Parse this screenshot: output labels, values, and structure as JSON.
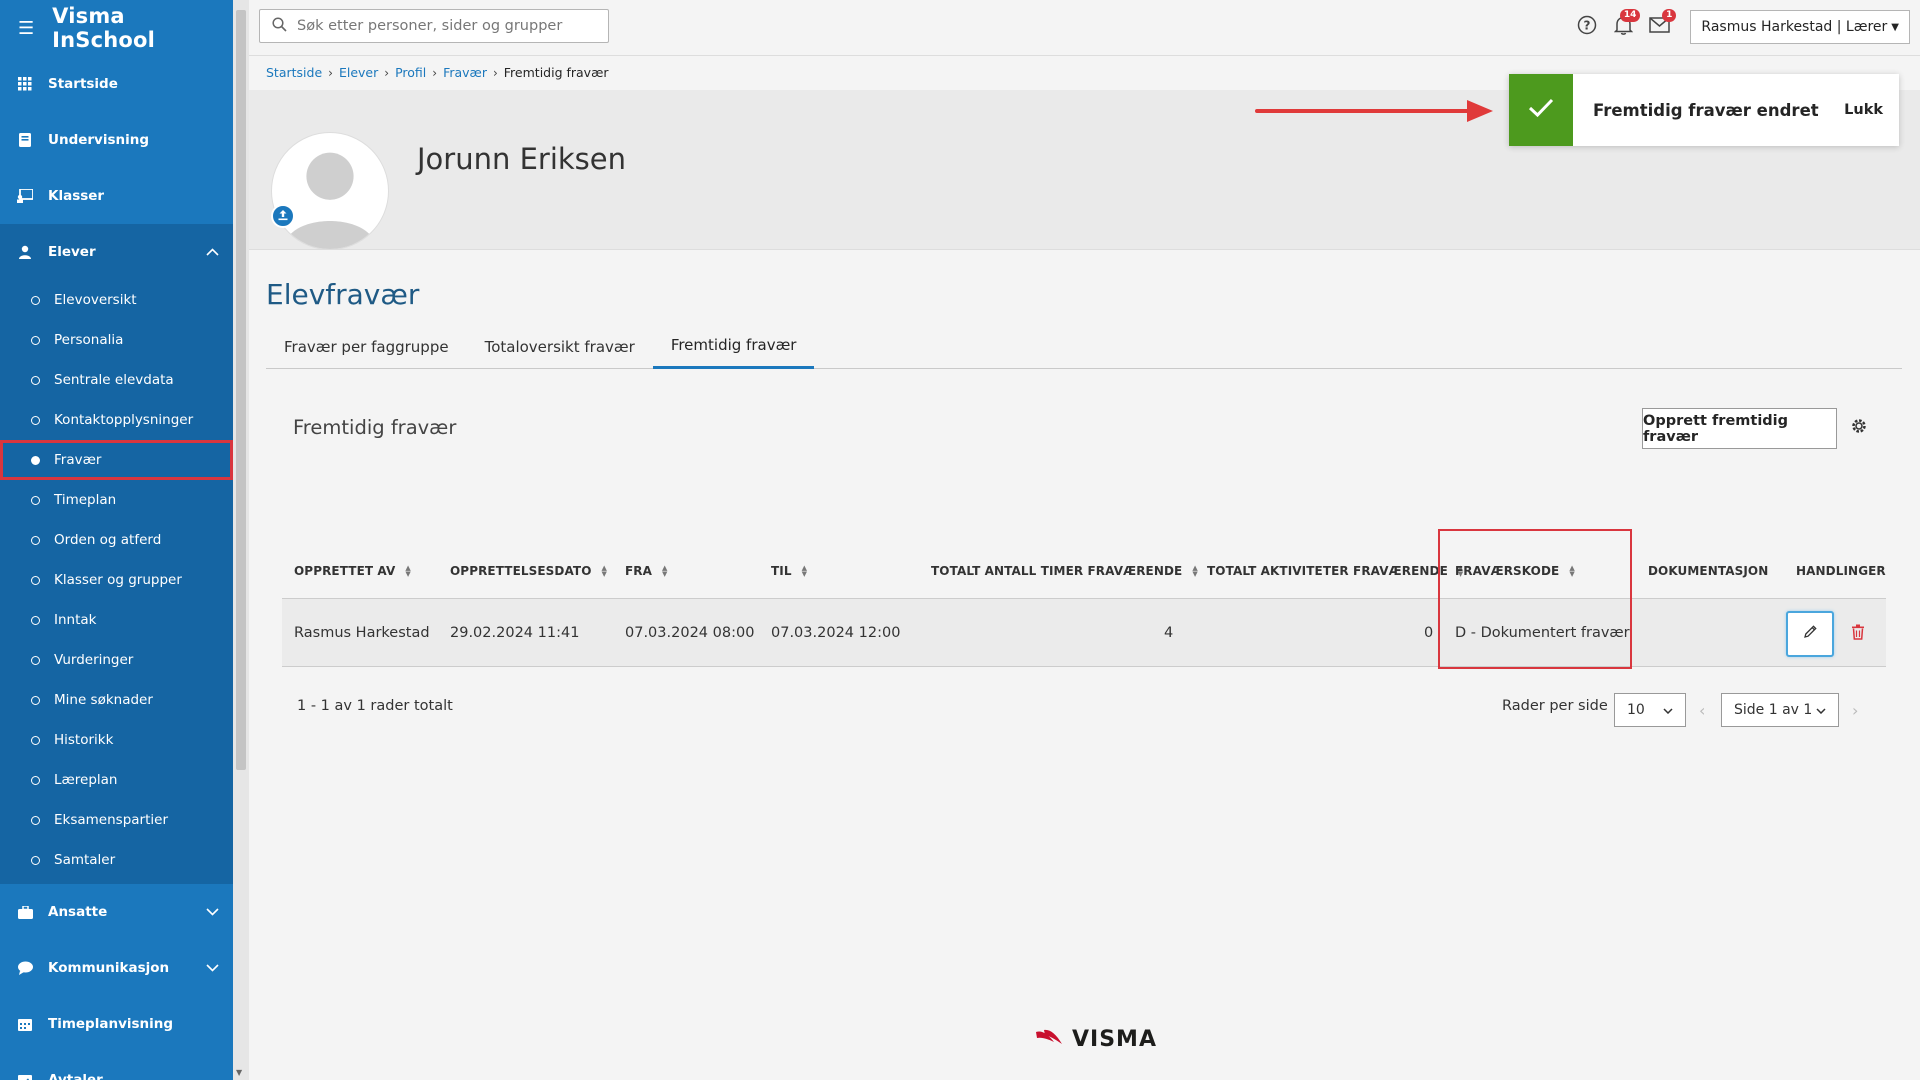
{
  "app": {
    "title": "Visma InSchool"
  },
  "sidebar": {
    "items": [
      {
        "label": "Startside",
        "icon": "grid-icon"
      },
      {
        "label": "Undervisning",
        "icon": "book-icon"
      },
      {
        "label": "Klasser",
        "icon": "board-icon"
      },
      {
        "label": "Elever",
        "icon": "student-icon"
      }
    ],
    "elever_sub": [
      "Elevoversikt",
      "Personalia",
      "Sentrale elevdata",
      "Kontaktopplysninger",
      "Fravær",
      "Timeplan",
      "Orden og atferd",
      "Klasser og grupper",
      "Inntak",
      "Vurderinger",
      "Mine søknader",
      "Historikk",
      "Læreplan",
      "Eksamenspartier",
      "Samtaler"
    ],
    "bottom_items": [
      {
        "label": "Ansatte",
        "icon": "briefcase-icon"
      },
      {
        "label": "Kommunikasjon",
        "icon": "chat-icon"
      },
      {
        "label": "Timeplanvisning",
        "icon": "calendar-icon"
      },
      {
        "label": "Avtaler",
        "icon": "calendar-check-icon"
      }
    ],
    "active_sub": "Fravær"
  },
  "topbar": {
    "search_placeholder": "Søk etter personer, sider og grupper",
    "notifications_count": "14",
    "messages_count": "1",
    "user_label": "Rasmus Harkestad | Lærer"
  },
  "breadcrumb": {
    "items": [
      "Startside",
      "Elever",
      "Profil",
      "Fravær"
    ],
    "current": "Fremtidig fravær"
  },
  "profile": {
    "name": "Jorunn Eriksen"
  },
  "toast": {
    "message": "Fremtidig fravær endret",
    "close_label": "Lukk"
  },
  "page": {
    "title": "Elevfravær",
    "tabs": [
      "Fravær per faggruppe",
      "Totaloversikt fravær",
      "Fremtidig fravær"
    ],
    "active_tab": "Fremtidig fravær"
  },
  "panel": {
    "title": "Fremtidig fravær",
    "create_button": "Opprett fremtidig fravær"
  },
  "table": {
    "columns": [
      "OPPRETTET AV",
      "OPPRETTELSESDATO",
      "FRA",
      "TIL",
      "TOTALT ANTALL TIMER FRAVÆRENDE",
      "TOTALT AKTIVITETER FRAVÆRENDE",
      "FRAVÆRSKODE",
      "DOKUMENTASJON",
      "HANDLINGER"
    ],
    "rows": [
      {
        "opprettet_av": "Rasmus Harkestad",
        "opprettelsesdato": "29.02.2024 11:41",
        "fra": "07.03.2024 08:00",
        "til": "07.03.2024 12:00",
        "timer": "4",
        "aktiviteter": "0",
        "kode": "D - Dokumentert fravær",
        "dokumentasjon": ""
      }
    ]
  },
  "pagination": {
    "summary": "1 - 1 av 1 rader totalt",
    "per_page_label": "Rader per side",
    "per_page_value": "10",
    "page_value": "Side 1 av 1"
  },
  "footer": {
    "logo_text": "VISMA"
  },
  "colors": {
    "sidebar": "#1b78bd",
    "success": "#4d9a1e",
    "highlight": "#d9363e",
    "title": "#1f5a85"
  }
}
